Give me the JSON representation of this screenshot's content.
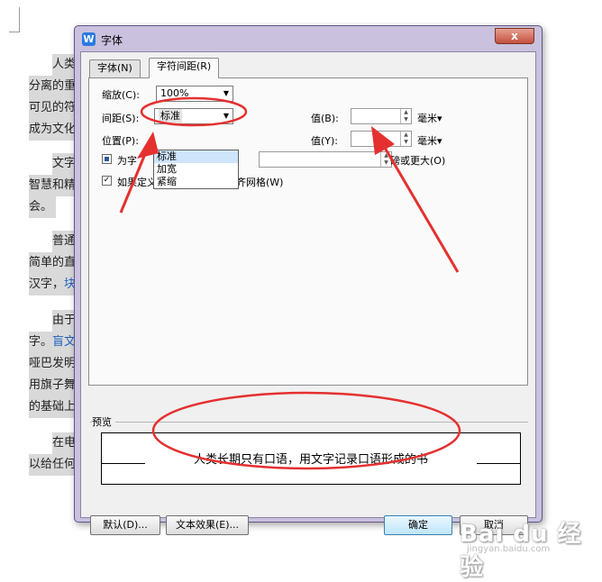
{
  "document": {
    "lines": [
      {
        "text": "人类",
        "indent": true
      },
      {
        "text": "分离的重"
      },
      {
        "text": "可见的符"
      },
      {
        "text": "成为文化"
      },
      {
        "text": "文字",
        "indent": true
      },
      {
        "text": "智慧和精"
      },
      {
        "text": "会。"
      },
      {
        "text": "普通",
        "indent": true
      },
      {
        "text": "简单的直"
      },
      {
        "text": "汉字，",
        "link": "块"
      },
      {
        "text": "由于",
        "indent": true
      },
      {
        "text": "字。",
        "link": "盲文"
      },
      {
        "text": "哑巴发明"
      },
      {
        "text": "用旗子舞"
      },
      {
        "text": "的基础上"
      },
      {
        "text": "在电",
        "indent": true
      },
      {
        "text": "以给任何"
      }
    ]
  },
  "dialog": {
    "title": "字体",
    "close_label": "x",
    "app_icon_letter": "W",
    "tabs": [
      {
        "label": "字体(N)",
        "active": false
      },
      {
        "label": "字符间距(R)",
        "active": true
      }
    ],
    "scale": {
      "label": "缩放(C):",
      "value": "100%"
    },
    "spacing": {
      "label": "间距(S):",
      "value": "标准",
      "options": [
        "标准",
        "加宽",
        "紧缩"
      ],
      "value_label": "值(B):",
      "unit": "毫米▾"
    },
    "position": {
      "label": "位置(P):",
      "value_label": "值(Y):",
      "unit": "毫米▾"
    },
    "kerning": {
      "label": "为字",
      "suffix": "磅或更大(O)",
      "checked": "partial"
    },
    "snap_grid": {
      "label": "如果定义了文档网格，则对齐网格(W)",
      "checked": true
    },
    "preview": {
      "label": "预览",
      "text": "人类长期只有口语，用文字记录口语形成的书"
    },
    "buttons": {
      "default": "默认(D)...",
      "text_effects": "文本效果(E)...",
      "ok": "确定",
      "cancel": "取消"
    }
  },
  "watermark": {
    "main": "Bai du 经验",
    "sub": "jingyan.baidu.com"
  },
  "colors": {
    "annotation": "#e53030",
    "dialog_frame": "#c9c1dd",
    "selection": "#cfe5fb"
  }
}
